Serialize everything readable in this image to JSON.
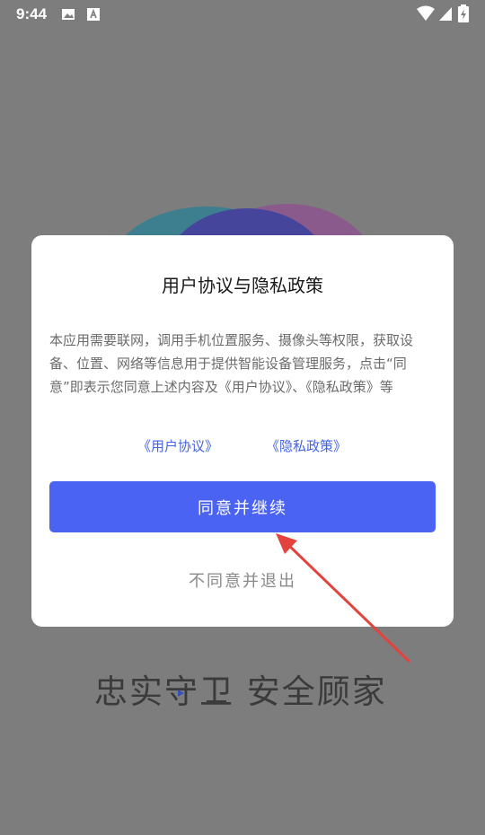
{
  "status_bar": {
    "time": "9:44",
    "left_icons": [
      "image-icon",
      "a-letter-icon"
    ],
    "right_icons": [
      "wifi-icon",
      "signal-icon",
      "battery-charging-icon"
    ]
  },
  "background": {
    "slogan": "忠实守卫 安全顾家"
  },
  "dialog": {
    "title": "用户协议与隐私政策",
    "body": "本应用需要联网，调用手机位置服务、摄像头等权限，获取设备、位置、网络等信息用于提供智能设备管理服务，点击“同意”即表示您同意上述内容及《用户协议》、《隐私政策》等",
    "links": {
      "user_agreement": "《用户协议》",
      "privacy_policy": "《隐私政策》"
    },
    "agree_label": "同意并继续",
    "disagree_label": "不同意并退出"
  },
  "colors": {
    "primary": "#4b63f2",
    "link": "#4463e0",
    "annotation_arrow": "#e2443d",
    "overlay": "#7d7d7d"
  }
}
